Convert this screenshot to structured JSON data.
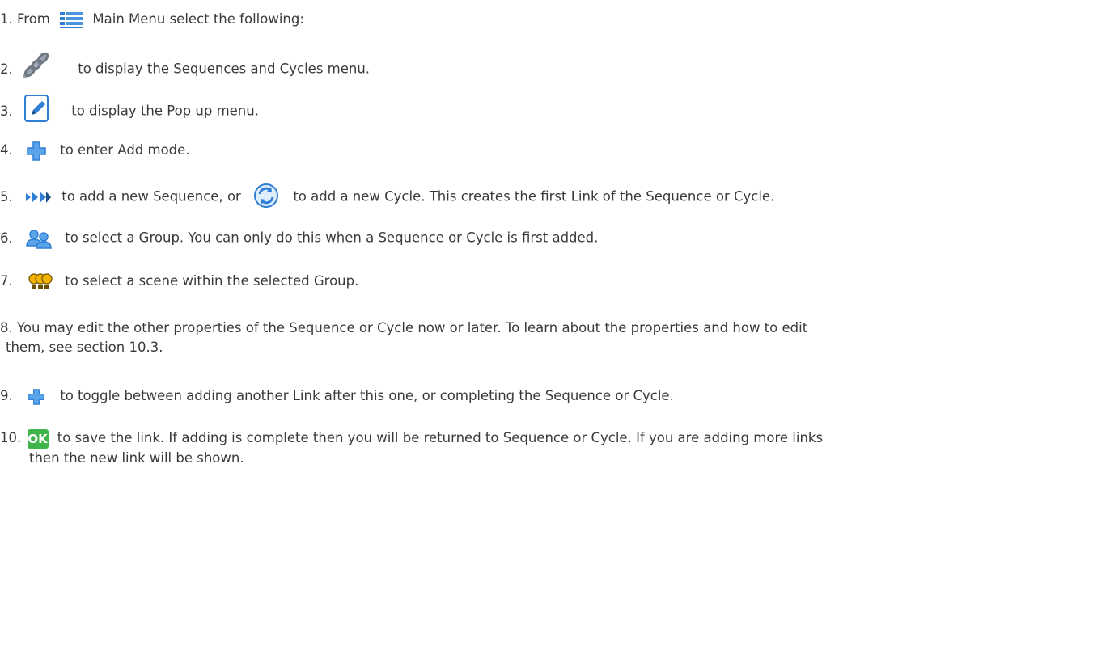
{
  "steps": [
    {
      "num": "1.",
      "pre": "From",
      "text": "Main Menu select the following:",
      "icon": "main-menu-icon"
    },
    {
      "num": "2.",
      "text": "to display the Sequences and Cycles menu.",
      "icon": "chain-link-icon"
    },
    {
      "num": "3.",
      "text": "to display the Pop up menu.",
      "icon": "edit-pencil-icon"
    },
    {
      "num": "4.",
      "text": "to enter Add mode.",
      "icon": "plus-icon"
    },
    {
      "num": "5.",
      "text_a": "to add a new Sequence, or",
      "text_b": "to add a new Cycle. This creates the first Link of the Sequence or Cycle.",
      "icon": "sequence-arrows-icon",
      "icon_b": "cycle-icon"
    },
    {
      "num": "6.",
      "text": "to select a Group. You can only do this when a Sequence or Cycle is first added.",
      "icon": "group-users-icon"
    },
    {
      "num": "7.",
      "text": "to select a scene within the selected Group.",
      "icon": "scene-bulbs-icon"
    },
    {
      "num": "8.",
      "text_line1": "You may edit the other properties of the Sequence or Cycle now or later. To learn about the properties and how to edit",
      "text_line2": "them, see section 10.3."
    },
    {
      "num": "9.",
      "text": "to toggle between adding another Link after this one, or completing the Sequence or Cycle.",
      "icon": "plus-icon"
    },
    {
      "num": "10.",
      "text_line1": "to save the link. If adding is complete then you will be returned to Sequence or Cycle. If you are adding more links",
      "text_line2": "then the new link will be shown.",
      "icon": "ok-button-icon",
      "icon_label": "OK"
    }
  ],
  "colors": {
    "text": "#3a3a3a",
    "icon_blue": "#2f7fd6",
    "ok_green": "#3fb54a"
  }
}
